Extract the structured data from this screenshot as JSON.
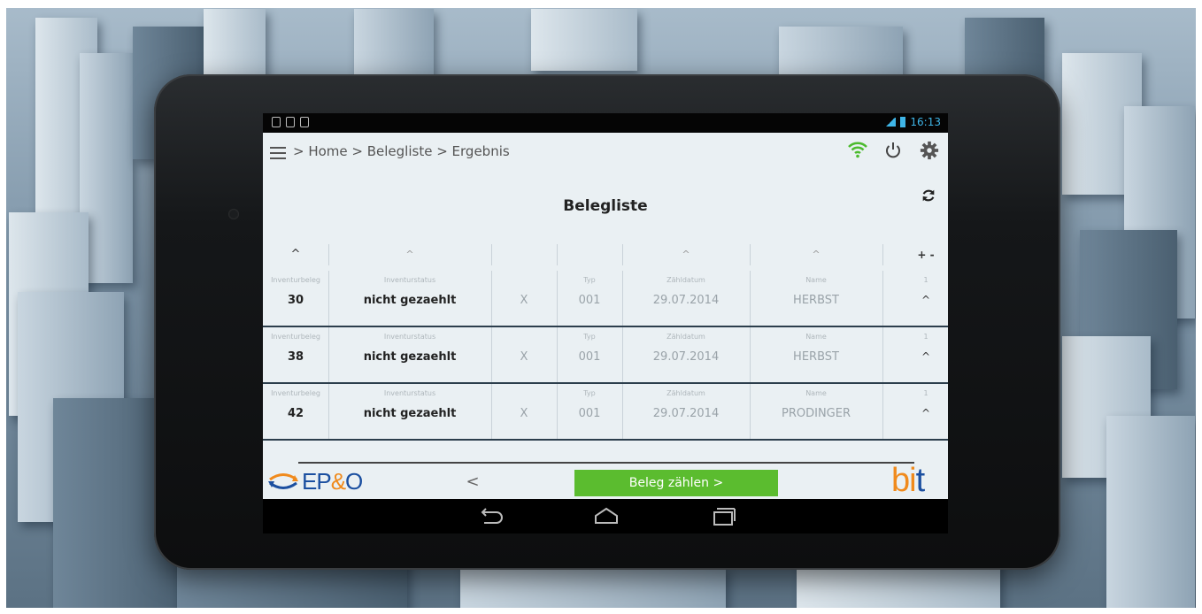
{
  "status_bar": {
    "time": "16:13"
  },
  "header": {
    "breadcrumb": "> Home > Belegliste > Ergebnis",
    "icons": [
      "menu-icon",
      "wifi-icon",
      "power-icon",
      "gear-icon"
    ]
  },
  "page": {
    "title": "Belegliste",
    "refresh_icon": "refresh-icon"
  },
  "table": {
    "plus_minus": "+ -",
    "labels": {
      "beleg": "Inventurbeleg",
      "status": "Inventurstatus",
      "typ": "Typ",
      "datum": "Zähldatum",
      "name": "Name",
      "count": "1"
    },
    "rows": [
      {
        "beleg": "30",
        "status": "nicht gezaehlt",
        "flag": "X",
        "typ": "001",
        "datum": "29.07.2014",
        "name": "HERBST"
      },
      {
        "beleg": "38",
        "status": "nicht gezaehlt",
        "flag": "X",
        "typ": "001",
        "datum": "29.07.2014",
        "name": "HERBST"
      },
      {
        "beleg": "42",
        "status": "nicht gezaehlt",
        "flag": "X",
        "typ": "001",
        "datum": "29.07.2014",
        "name": "PRODINGER"
      }
    ]
  },
  "footer": {
    "logo_left": {
      "a": "EP",
      "amp": "&",
      "b": "O"
    },
    "back_label": "<",
    "count_button": "Beleg zählen >",
    "logo_right": {
      "a": "bi",
      "b": "t"
    }
  },
  "colors": {
    "accent_green": "#5bbc2f",
    "brand_blue": "#1b4fa0",
    "brand_orange": "#f08a1c",
    "wifi_green": "#4cbb2e"
  }
}
